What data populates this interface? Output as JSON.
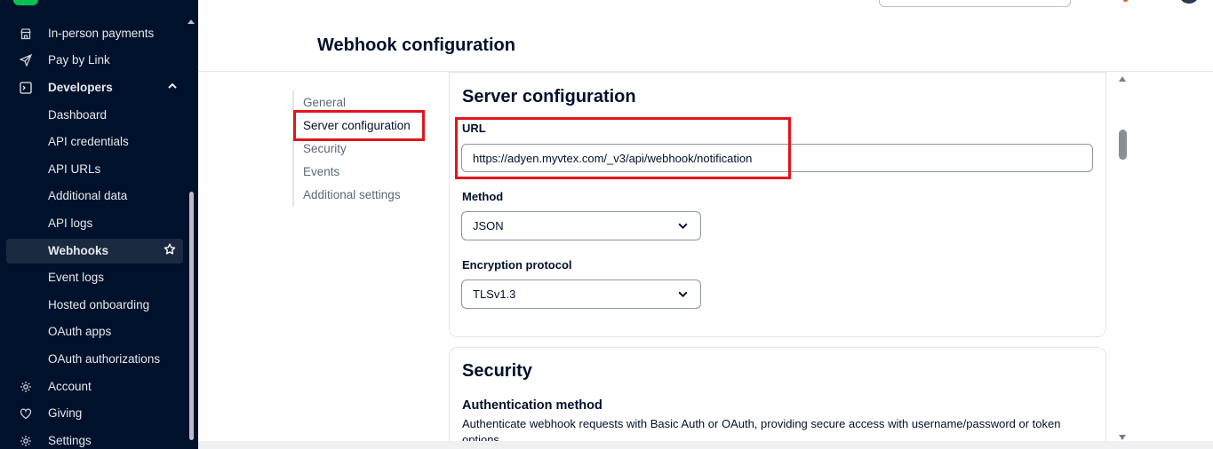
{
  "sidebar": {
    "items": [
      {
        "label": "In-person payments",
        "icon": "store-icon",
        "type": "section"
      },
      {
        "label": "Pay by Link",
        "icon": "send-icon",
        "type": "section"
      },
      {
        "label": "Developers",
        "icon": "terminal-icon",
        "type": "parent",
        "expanded": true
      },
      {
        "label": "Dashboard",
        "type": "child"
      },
      {
        "label": "API credentials",
        "type": "child"
      },
      {
        "label": "API URLs",
        "type": "child"
      },
      {
        "label": "Additional data",
        "type": "child"
      },
      {
        "label": "API logs",
        "type": "child"
      },
      {
        "label": "Webhooks",
        "type": "child",
        "active": true,
        "starred": true
      },
      {
        "label": "Event logs",
        "type": "child"
      },
      {
        "label": "Hosted onboarding",
        "type": "child"
      },
      {
        "label": "OAuth apps",
        "type": "child"
      },
      {
        "label": "OAuth authorizations",
        "type": "child"
      },
      {
        "label": "Account",
        "icon": "gear-icon",
        "type": "section"
      },
      {
        "label": "Giving",
        "icon": "heart-icon",
        "type": "section"
      },
      {
        "label": "Settings",
        "icon": "gear-icon",
        "type": "section"
      }
    ]
  },
  "page": {
    "title": "Webhook configuration"
  },
  "subnav": {
    "items": [
      "General",
      "Server configuration",
      "Security",
      "Events",
      "Additional settings"
    ],
    "active": "Server configuration"
  },
  "server_config": {
    "title": "Server configuration",
    "url_label": "URL",
    "url_value": "https://adyen.myvtex.com/_v3/api/webhook/notification",
    "method_label": "Method",
    "method_value": "JSON",
    "encryption_label": "Encryption protocol",
    "encryption_value": "TLSv1.3"
  },
  "security": {
    "title": "Security",
    "auth_heading": "Authentication method",
    "auth_desc": "Authenticate webhook requests with Basic Auth or OAuth, providing secure access with username/password or token options."
  },
  "colors": {
    "sidebar_bg": "#00112c",
    "brand_green": "#0abf53",
    "highlight_red": "#e3141d"
  }
}
